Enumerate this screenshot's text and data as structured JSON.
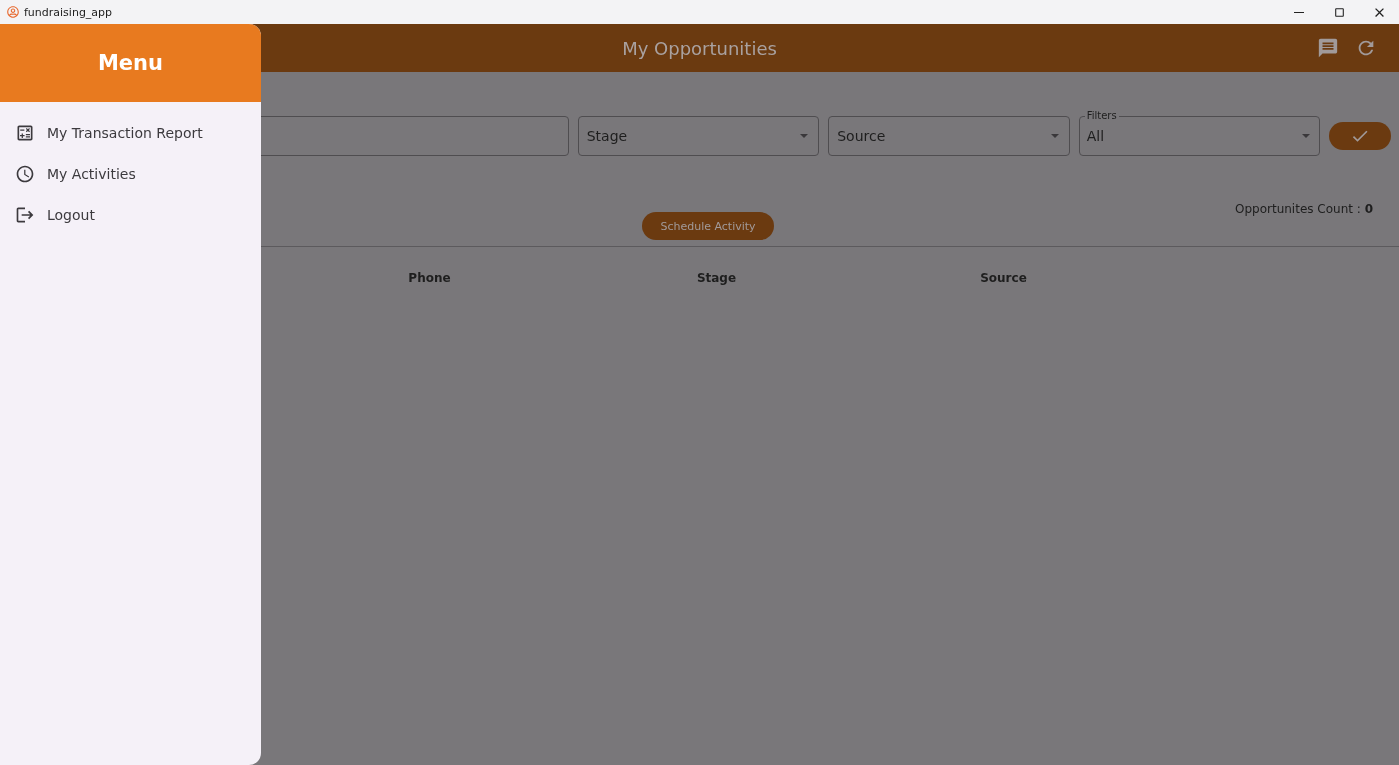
{
  "window": {
    "title": "fundraising_app"
  },
  "header": {
    "title": "My Opportunities"
  },
  "filters": {
    "stage": {
      "placeholder": "Stage"
    },
    "source": {
      "placeholder": "Source"
    },
    "filters": {
      "label": "Filters",
      "value": "All"
    }
  },
  "count": {
    "label": "Opportunites Count : ",
    "value": "0"
  },
  "schedule_button": "Schedule Activity",
  "table": {
    "columns": [
      "Phone",
      "Stage",
      "Source"
    ]
  },
  "drawer": {
    "title": "Menu",
    "items": [
      {
        "kind": "report",
        "label": "My Transaction Report"
      },
      {
        "kind": "activities",
        "label": "My Activities"
      },
      {
        "kind": "logout",
        "label": "Logout"
      }
    ]
  }
}
